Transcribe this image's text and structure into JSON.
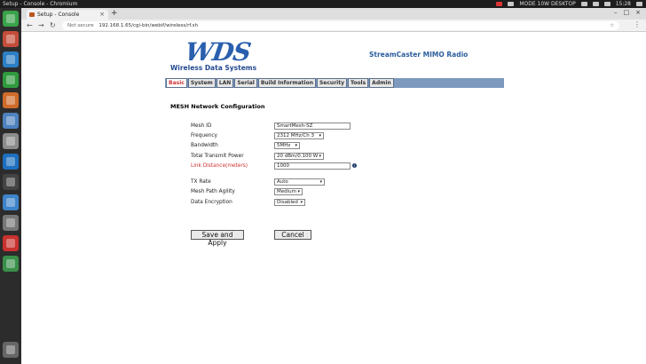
{
  "os": {
    "window_title": "Setup - Console - Chromium",
    "topbar_status": "MODE 10W DESKTOP",
    "clock": "15:28"
  },
  "browser": {
    "tab_title": "Setup - Console",
    "new_tab": "+",
    "not_secure": "Not secure",
    "url": "192.168.1.65/cgi-bin/webif/wireless/rf.sh"
  },
  "header": {
    "logo_mark": "WDS",
    "logo_text": "Wireless Data Systems",
    "product": "StreamCaster MIMO Radio"
  },
  "nav": {
    "tabs": [
      "Basic",
      "System",
      "LAN",
      "Serial",
      "Build Information",
      "Security",
      "Tools",
      "Admin"
    ],
    "active": "Basic"
  },
  "form": {
    "title": "MESH Network Configuration",
    "fields": [
      {
        "label": "Mesh ID",
        "value": "SmartMesh-SZ",
        "type": "text"
      },
      {
        "label": "Frequency",
        "value": "2312 MHz/Ch 3",
        "type": "select"
      },
      {
        "label": "Bandwidth",
        "value": "5MHz",
        "type": "select"
      },
      {
        "label": "Total Transmit Power",
        "value": "20 dBm/0.100 W",
        "type": "select"
      },
      {
        "label": "Link Distance(meters)",
        "value": "1000",
        "type": "text",
        "highlight": true
      },
      {
        "label": "TX Rate",
        "value": "Auto",
        "type": "select"
      },
      {
        "label": "Mesh Path Agility",
        "value": "Medium",
        "type": "select"
      },
      {
        "label": "Data Encryption",
        "value": "Disabled",
        "type": "select"
      }
    ],
    "save_label": "Save and Apply",
    "cancel_label": "Cancel"
  },
  "colors": {
    "nav_bg": "#7d99bd",
    "brand_blue": "#2b5e9e",
    "active_tab": "#c33",
    "highlight_label": "#d03030"
  }
}
